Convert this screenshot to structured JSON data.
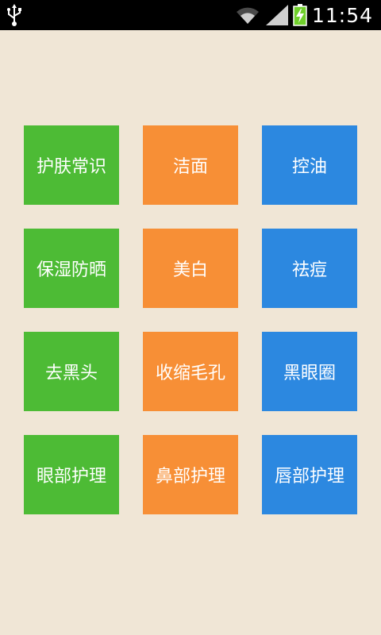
{
  "status_bar": {
    "time": "11:54",
    "icons": [
      "usb-icon",
      "wifi-icon",
      "signal-icon",
      "battery-charging-icon"
    ]
  },
  "colors": {
    "background": "#f0e6d6",
    "green": "#4dbb35",
    "orange": "#f78f36",
    "blue": "#2c88e0"
  },
  "tiles": [
    {
      "label": "护肤常识",
      "color": "#4dbb35"
    },
    {
      "label": "洁面",
      "color": "#f78f36"
    },
    {
      "label": "控油",
      "color": "#2c88e0"
    },
    {
      "label": "保湿防晒",
      "color": "#4dbb35"
    },
    {
      "label": "美白",
      "color": "#f78f36"
    },
    {
      "label": "祛痘",
      "color": "#2c88e0"
    },
    {
      "label": "去黑头",
      "color": "#4dbb35"
    },
    {
      "label": "收缩毛孔",
      "color": "#f78f36"
    },
    {
      "label": "黑眼圈",
      "color": "#2c88e0"
    },
    {
      "label": "眼部护理",
      "color": "#4dbb35"
    },
    {
      "label": "鼻部护理",
      "color": "#f78f36"
    },
    {
      "label": "唇部护理",
      "color": "#2c88e0"
    }
  ]
}
